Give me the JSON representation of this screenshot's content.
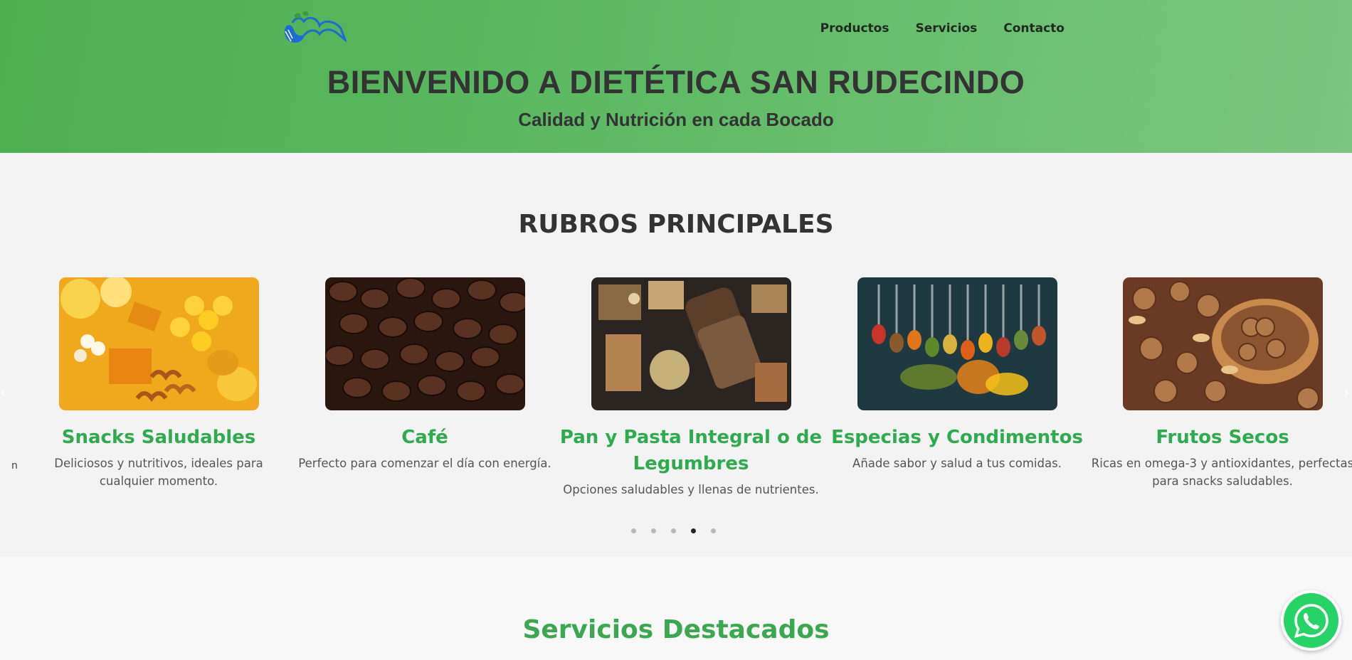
{
  "brand": {
    "logo_icon": "apple-book-logo"
  },
  "nav": {
    "items": [
      {
        "label": "Productos"
      },
      {
        "label": "Servicios"
      },
      {
        "label": "Contacto"
      }
    ]
  },
  "hero": {
    "title": "BIENVENIDO A DIETÉTICA SAN RUDECINDO",
    "subtitle": "Calidad y Nutrición en cada Bocado"
  },
  "rubros": {
    "title": "RUBROS PRINCIPALES",
    "cards": [
      {
        "name": "Snacks Saludables",
        "desc": "Deliciosos y nutritivos, ideales para cualquier momento.",
        "image": "snacks-photo"
      },
      {
        "name": "Café",
        "desc": "Perfecto para comenzar el día con energía.",
        "image": "coffee-beans-photo"
      },
      {
        "name": "Pan y Pasta Integral o de Legumbres",
        "desc": "Opciones saludables y llenas de nutrientes.",
        "image": "bread-pasta-photo"
      },
      {
        "name": "Especias y Condimentos",
        "desc": "Añade sabor y salud a tus comidas.",
        "image": "spices-photo"
      },
      {
        "name": "Frutos Secos",
        "desc": "Ricas en omega-3 y antioxidantes, perfectas para snacks saludables.",
        "image": "nuts-photo"
      }
    ],
    "stray_text": "n",
    "carousel": {
      "total": 5,
      "active_index": 3
    }
  },
  "servicios": {
    "title": "Servicios Destacados"
  },
  "whatsapp": {
    "icon": "whatsapp-icon"
  },
  "colors": {
    "accent": "#2eab4d",
    "header_start": "#4caf50",
    "header_end": "#7cc67f"
  }
}
